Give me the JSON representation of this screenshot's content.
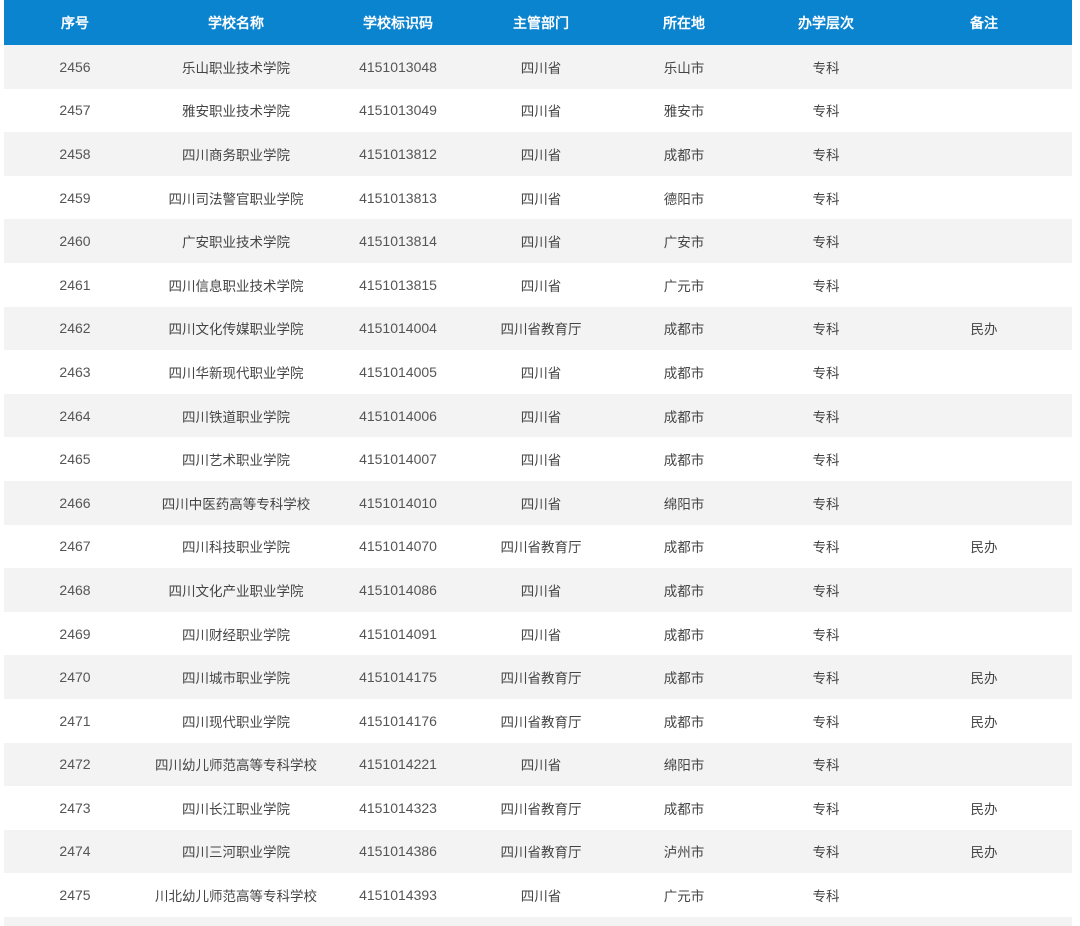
{
  "columns": [
    "序号",
    "学校名称",
    "学校标识码",
    "主管部门",
    "所在地",
    "办学层次",
    "备注"
  ],
  "rows": [
    [
      "2456",
      "乐山职业技术学院",
      "4151013048",
      "四川省",
      "乐山市",
      "专科",
      ""
    ],
    [
      "2457",
      "雅安职业技术学院",
      "4151013049",
      "四川省",
      "雅安市",
      "专科",
      ""
    ],
    [
      "2458",
      "四川商务职业学院",
      "4151013812",
      "四川省",
      "成都市",
      "专科",
      ""
    ],
    [
      "2459",
      "四川司法警官职业学院",
      "4151013813",
      "四川省",
      "德阳市",
      "专科",
      ""
    ],
    [
      "2460",
      "广安职业技术学院",
      "4151013814",
      "四川省",
      "广安市",
      "专科",
      ""
    ],
    [
      "2461",
      "四川信息职业技术学院",
      "4151013815",
      "四川省",
      "广元市",
      "专科",
      ""
    ],
    [
      "2462",
      "四川文化传媒职业学院",
      "4151014004",
      "四川省教育厅",
      "成都市",
      "专科",
      "民办"
    ],
    [
      "2463",
      "四川华新现代职业学院",
      "4151014005",
      "四川省",
      "成都市",
      "专科",
      ""
    ],
    [
      "2464",
      "四川铁道职业学院",
      "4151014006",
      "四川省",
      "成都市",
      "专科",
      ""
    ],
    [
      "2465",
      "四川艺术职业学院",
      "4151014007",
      "四川省",
      "成都市",
      "专科",
      ""
    ],
    [
      "2466",
      "四川中医药高等专科学校",
      "4151014010",
      "四川省",
      "绵阳市",
      "专科",
      ""
    ],
    [
      "2467",
      "四川科技职业学院",
      "4151014070",
      "四川省教育厅",
      "成都市",
      "专科",
      "民办"
    ],
    [
      "2468",
      "四川文化产业职业学院",
      "4151014086",
      "四川省",
      "成都市",
      "专科",
      ""
    ],
    [
      "2469",
      "四川财经职业学院",
      "4151014091",
      "四川省",
      "成都市",
      "专科",
      ""
    ],
    [
      "2470",
      "四川城市职业学院",
      "4151014175",
      "四川省教育厅",
      "成都市",
      "专科",
      "民办"
    ],
    [
      "2471",
      "四川现代职业学院",
      "4151014176",
      "四川省教育厅",
      "成都市",
      "专科",
      "民办"
    ],
    [
      "2472",
      "四川幼儿师范高等专科学校",
      "4151014221",
      "四川省",
      "绵阳市",
      "专科",
      ""
    ],
    [
      "2473",
      "四川长江职业学院",
      "4151014323",
      "四川省教育厅",
      "成都市",
      "专科",
      "民办"
    ],
    [
      "2474",
      "四川三河职业学院",
      "4151014386",
      "四川省教育厅",
      "泸州市",
      "专科",
      "民办"
    ],
    [
      "2475",
      "川北幼儿师范高等专科学校",
      "4151014393",
      "四川省",
      "广元市",
      "专科",
      ""
    ]
  ],
  "colors": {
    "header_bg": "#0b84d0",
    "header_text": "#ffffff",
    "row_odd": "#f3f3f3",
    "row_even": "#ffffff",
    "cell_text": "#444444"
  }
}
